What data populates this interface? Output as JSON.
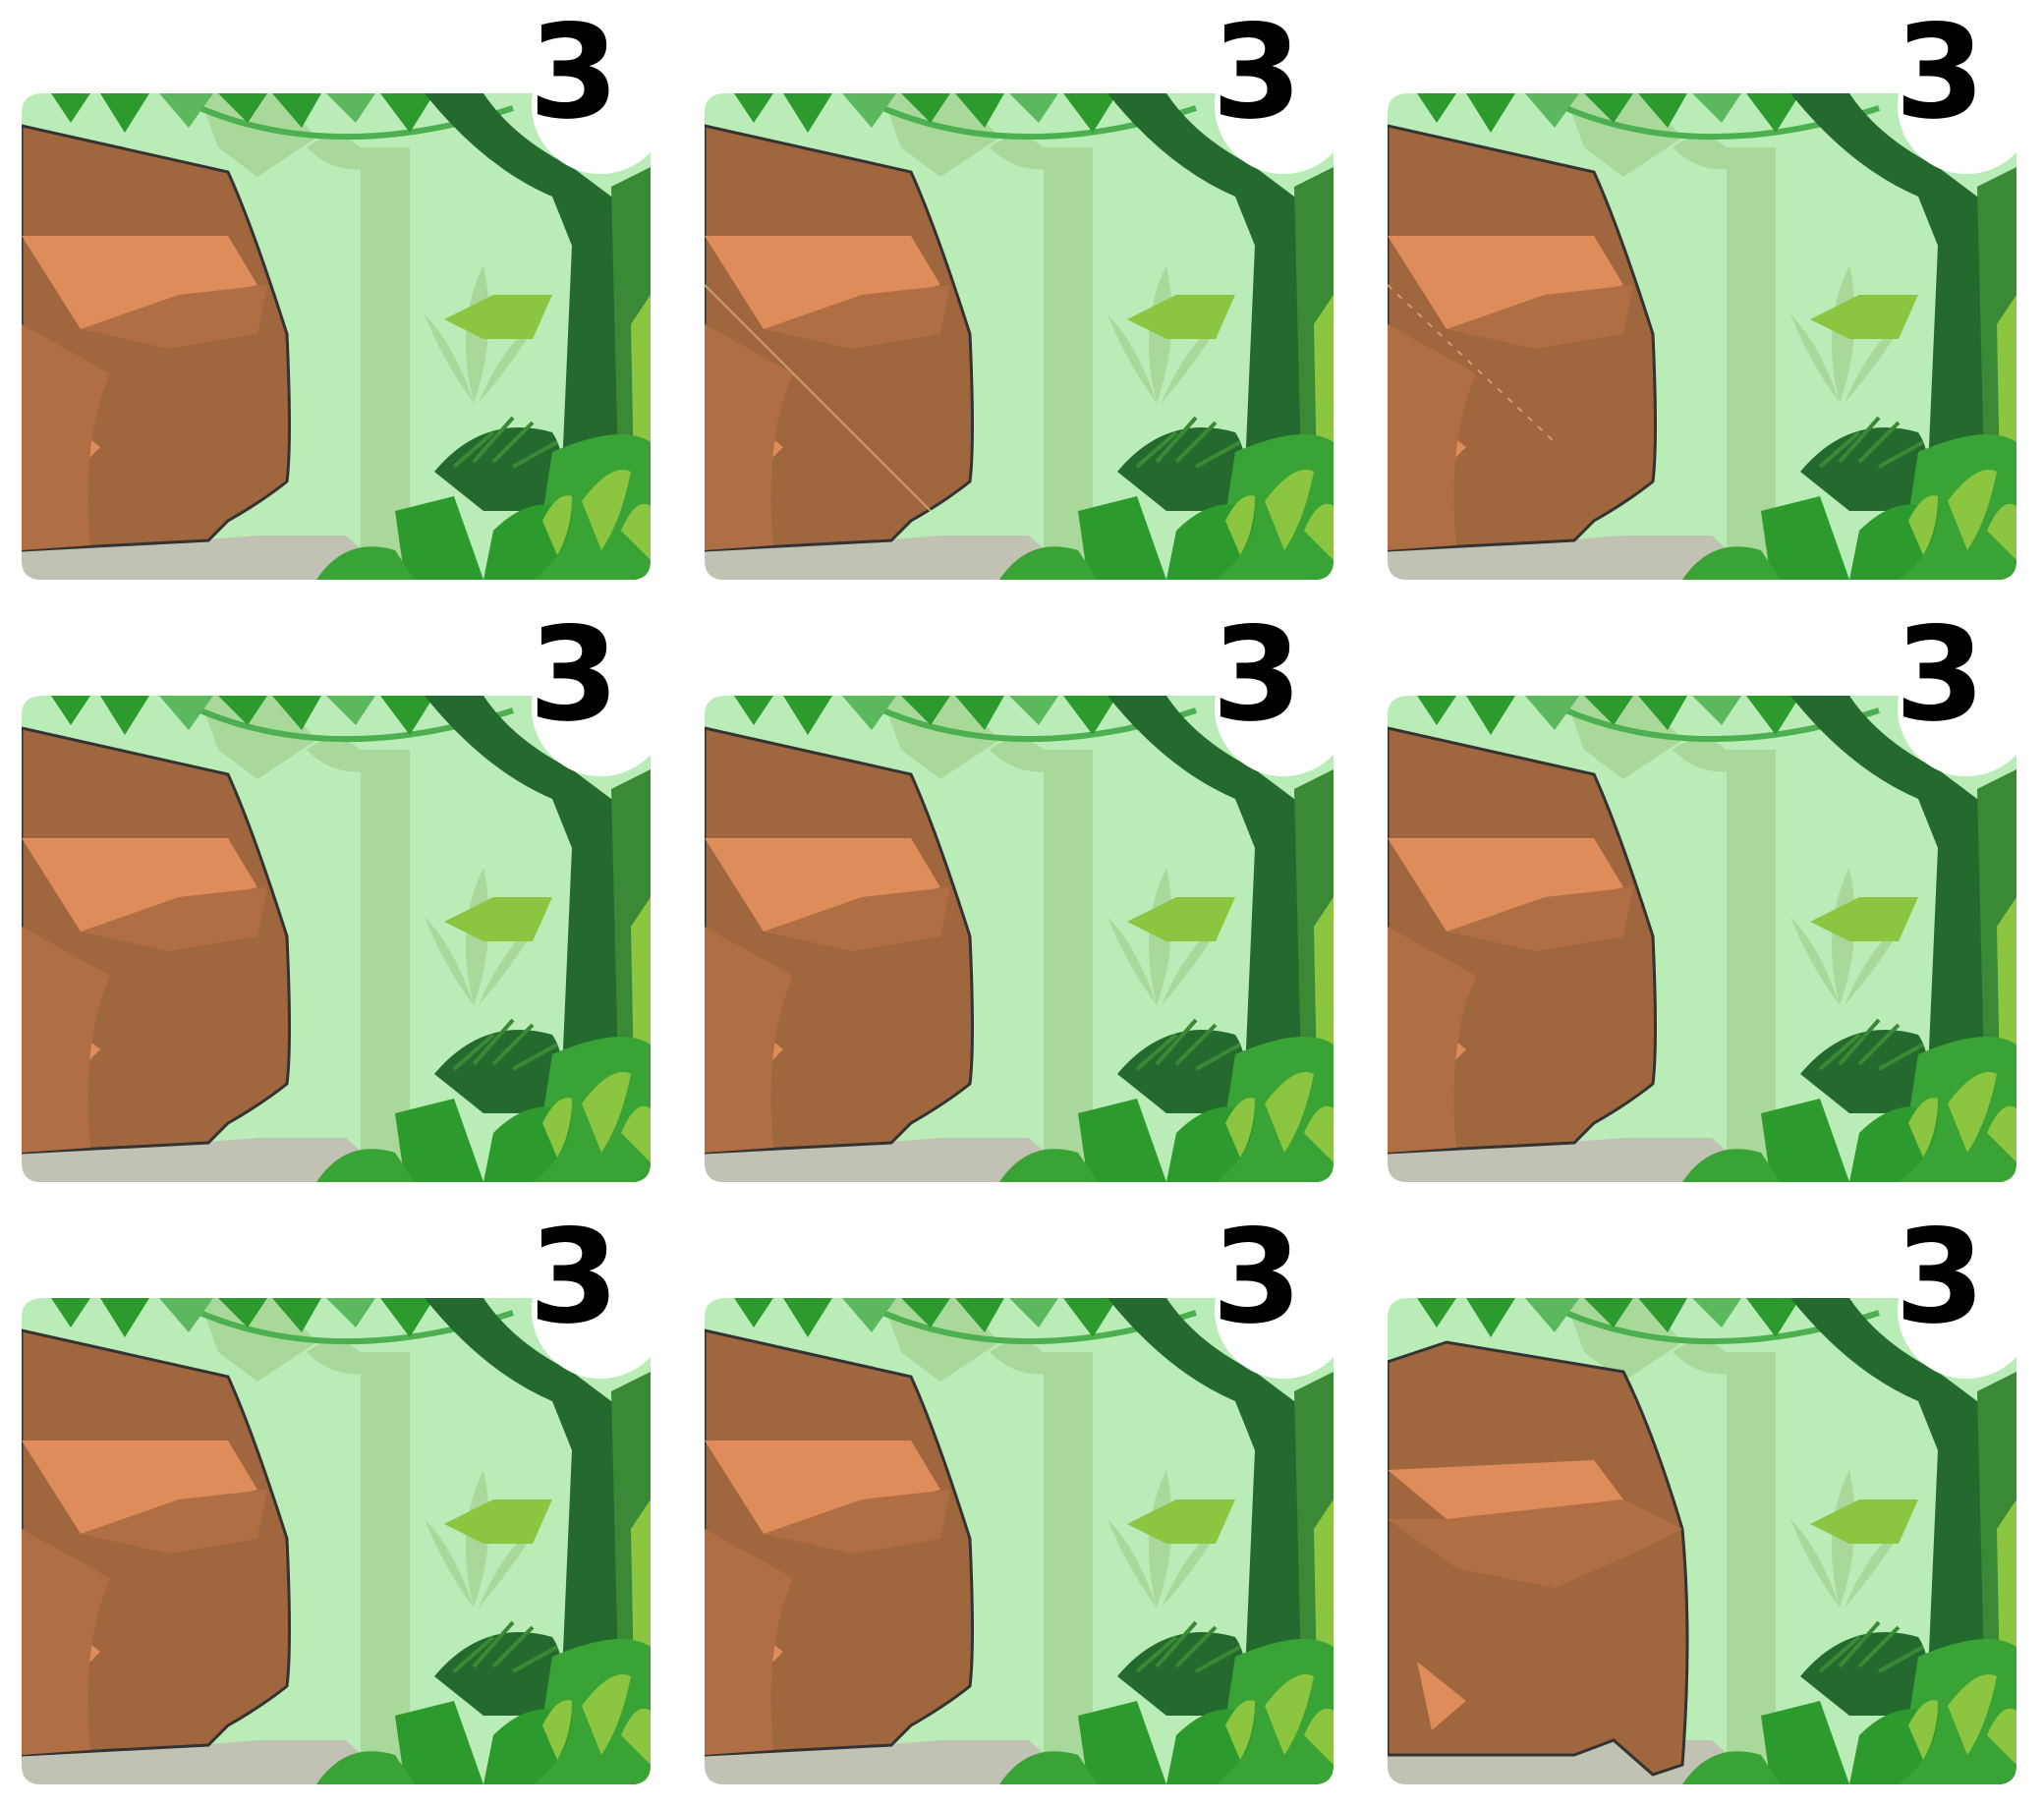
{
  "cards": [
    {
      "number": "3",
      "variant": "a"
    },
    {
      "number": "3",
      "variant": "b"
    },
    {
      "number": "3",
      "variant": "c"
    },
    {
      "number": "3",
      "variant": "a"
    },
    {
      "number": "3",
      "variant": "a"
    },
    {
      "number": "3",
      "variant": "a"
    },
    {
      "number": "3",
      "variant": "a"
    },
    {
      "number": "3",
      "variant": "a"
    },
    {
      "number": "3",
      "variant": "d"
    }
  ],
  "colors": {
    "sky": "#b9ecb7",
    "canopy_dark": "#2d9a2d",
    "canopy_light": "#5cb85c",
    "trunk": "#246a2f",
    "rock_main": "#a0663d",
    "rock_light": "#de8c59",
    "rock_mid": "#b06e44",
    "ground": "#c2c2b4",
    "badge": "#ffffff"
  }
}
